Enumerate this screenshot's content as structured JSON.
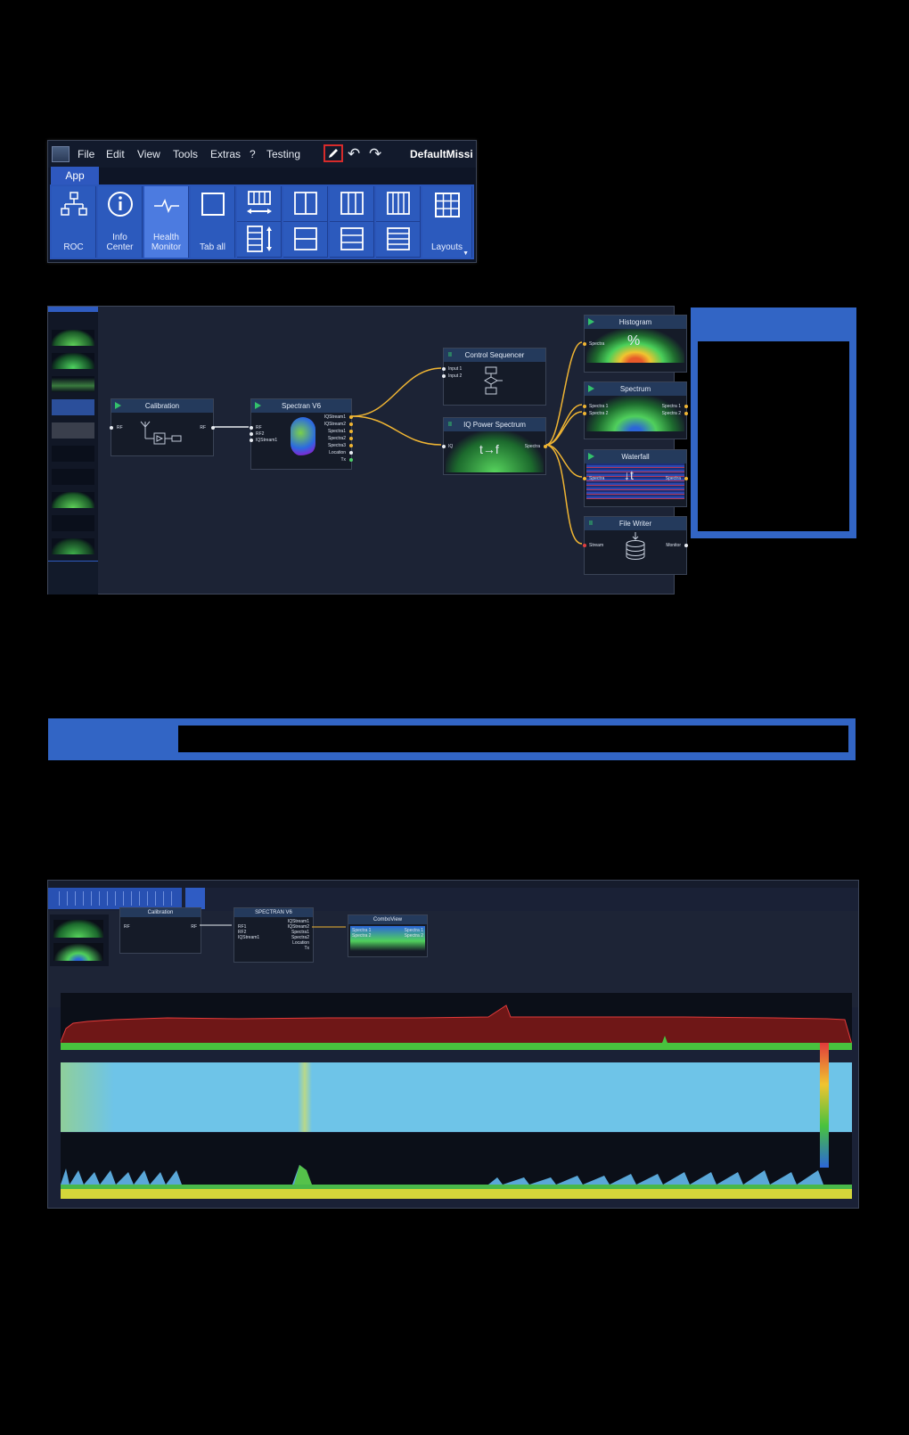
{
  "ribbon": {
    "menu": [
      "File",
      "Edit",
      "View",
      "Tools",
      "Extras",
      "?",
      "Testing"
    ],
    "mission_name": "DefaultMissi",
    "tab": "App",
    "buttons": {
      "roc": "ROC",
      "info_center_1": "Info",
      "info_center_2": "Center",
      "health_1": "Health",
      "health_2": "Monitor",
      "tab_all": "Tab all",
      "layouts": "Layouts"
    },
    "accent": "#2a55b8",
    "highlight": "#d62b2b"
  },
  "graph": {
    "nodes": {
      "calibration": {
        "title": "Calibration",
        "in": "RF",
        "out": "RF"
      },
      "spectran": {
        "title": "Spectran V6",
        "in": [
          "RF",
          "RF2",
          "IQStream1"
        ],
        "out": [
          "IQStream1",
          "IQStream2",
          "Spectra1",
          "Spectra2",
          "Spectra3",
          "Location",
          "Tx"
        ]
      },
      "control_sequencer": {
        "title": "Control Sequencer",
        "in": [
          "Input 1",
          "Input 2"
        ]
      },
      "iq_power": {
        "title": "IQ Power Spectrum",
        "in": "IQ",
        "out": "Spectra",
        "glyph": "t→f"
      },
      "histogram": {
        "title": "Histogram",
        "in": "Spectra",
        "glyph": "%"
      },
      "spectrum": {
        "title": "Spectrum",
        "in": [
          "Spectra 1",
          "Spectra 2"
        ],
        "out": [
          "Spectra 1",
          "Spectra 2"
        ]
      },
      "waterfall": {
        "title": "Waterfall",
        "in": "Spectra",
        "out": "Spectra",
        "glyph": "↓t"
      },
      "file_writer": {
        "title": "File Writer",
        "in": "Stream",
        "out": "Monitor"
      }
    },
    "wire_color": "#f0b533"
  },
  "bottom": {
    "nodes": {
      "calibration": {
        "title": "Calibration",
        "in": "RF",
        "out": "RF"
      },
      "spectran": {
        "title": "SPECTRAN V6",
        "in": [
          "RF1",
          "RF2",
          "IQStream1"
        ],
        "out": [
          "IQStream1",
          "IQStream2",
          "Spectra1",
          "Spectra2",
          "Location",
          "Tx"
        ]
      },
      "combo": {
        "title": "ComboView",
        "in": [
          "Spectra 1",
          "Spectra 2"
        ],
        "out": [
          "Spectra 1",
          "Spectra 2"
        ]
      }
    }
  }
}
